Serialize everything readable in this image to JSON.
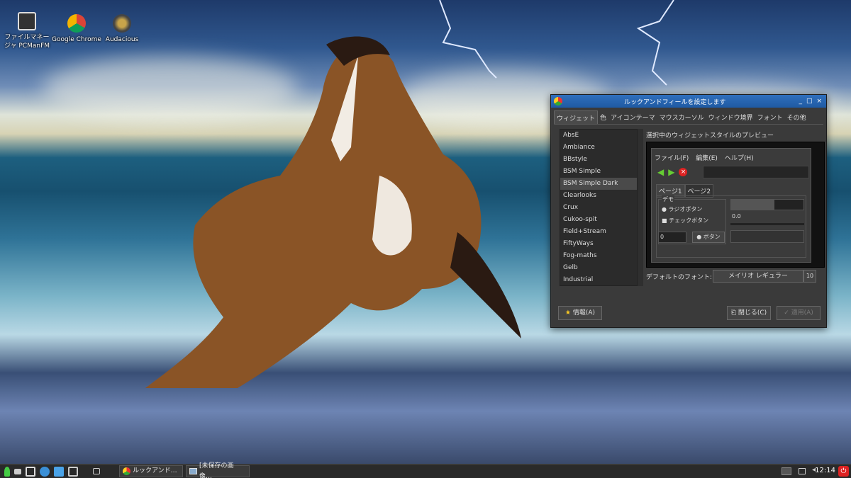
{
  "desktop": {
    "icons": [
      {
        "label": "ファイルマネージャ PCManFM"
      },
      {
        "label": "Google Chrome"
      },
      {
        "label": "Audacious"
      }
    ]
  },
  "window": {
    "title": "ルックアンドフィールを設定します",
    "controls": [
      "_",
      "□",
      "×"
    ],
    "tabs": [
      "ウィジェット",
      "色",
      "アイコンテーマ",
      "マウスカーソル",
      "ウィンドウ境界",
      "フォント",
      "その他"
    ],
    "themes": [
      "AbsE",
      "Ambiance",
      "BBstyle",
      "BSM Simple",
      "BSM Simple Dark",
      "Clearlooks",
      "Crux",
      "Cukoo-spit",
      "Field+Stream",
      "FiftyWays",
      "Fog-maths",
      "Gelb",
      "Industrial"
    ],
    "selected_theme": "BSM Simple Dark",
    "preview_label": "選択中のウィジェットスタイルのプレビュー",
    "preview": {
      "menu": [
        "ファイル(F)",
        "編集(E)",
        "ヘルプ(H)"
      ],
      "tabs": [
        "ページ1",
        "ページ2"
      ],
      "demo_label": "デモ",
      "radio_label": "ラジオボタン",
      "check_label": "チェックボタン",
      "spin_value": "0",
      "button_label": "ボタン",
      "progress_fraction": 0.6,
      "scale_value": "0.0"
    },
    "font_label": "デフォルトのフォント:",
    "font_name": "メイリオ レギュラー",
    "font_size": "10",
    "about_button": "情報(A)",
    "close_button": "閉じる(C)",
    "apply_button": "適用(A)"
  },
  "taskbar": {
    "tasks": [
      "ルックアンド…",
      "[未保存の画像…"
    ],
    "clock": "12:14"
  }
}
